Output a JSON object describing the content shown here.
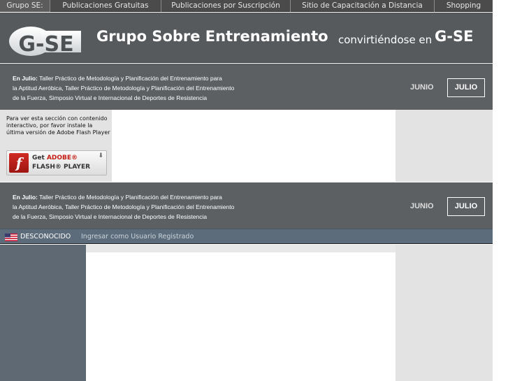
{
  "nav": {
    "tabs": [
      {
        "label": "Grupo SE:"
      },
      {
        "label": "Publicaciones Gratuitas"
      },
      {
        "label": "Publicaciones por Suscripción"
      },
      {
        "label": "Sitio de Capacitación a Distancia"
      },
      {
        "label": "Shopping"
      }
    ]
  },
  "header": {
    "logo_text": "G-SE",
    "title": "Grupo Sobre Entrenamiento",
    "subtitle": "convirtiéndose en",
    "brand": "G-SE"
  },
  "news": {
    "lead": "En Julio:",
    "line1": "Taller Práctico de Metodología y Planificación del Entrenamiento para",
    "line2": "la Aptitud Aeróbica, Taller Práctico de Metodología y Planificación del Entrenamiento",
    "line3": "de la Fuerza, Simposio Virtual e Internacional de Deportes de Resistencia",
    "junio_label": "JUNIO",
    "julio_label": "JULIO"
  },
  "flash": {
    "message": "Para ver esta sección con contenido interactivo, por favor instale la última versión de Adobe Flash Player",
    "btn_get": "Get",
    "btn_adobe": "ADOBE®",
    "btn_player": "FLASH® PLAYER",
    "icon_letter": "f"
  },
  "userbar": {
    "status": "DESCONOCIDO",
    "login": "Ingresar como Usuario Registrado"
  },
  "colors": {
    "nav_bg": "#4b4b4b",
    "banner_bg": "#575a5d",
    "news_bg": "#5d6063",
    "userbar_bg": "#5d6c7a",
    "sidebar_bg": "#5f6973",
    "panel_gray": "#e3e3e3",
    "flash_red": "#c41e14"
  }
}
